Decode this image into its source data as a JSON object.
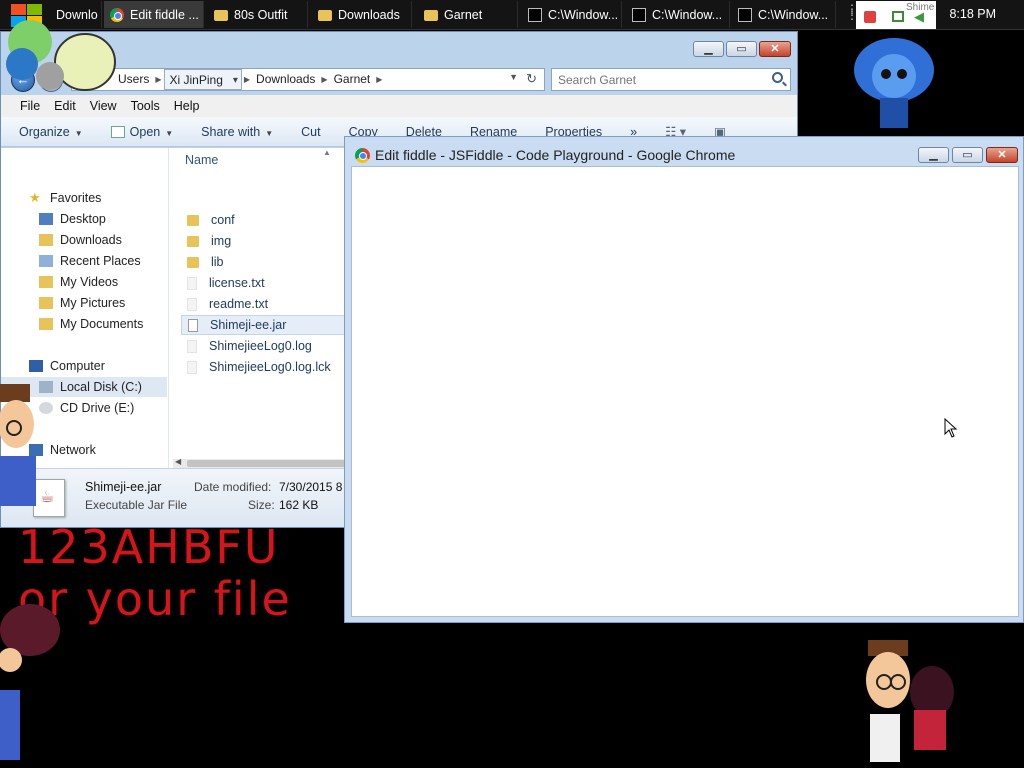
{
  "taskbar": {
    "items": [
      {
        "label": "Downlo"
      },
      {
        "label": "Edit fiddle ..."
      },
      {
        "label": "80s Outfit"
      },
      {
        "label": "Downloads"
      },
      {
        "label": "Garnet"
      },
      {
        "label": "C:\\Window..."
      },
      {
        "label": "C:\\Window..."
      },
      {
        "label": "C:\\Window..."
      }
    ],
    "tray_label": "Shime",
    "clock": "8:18 PM"
  },
  "explorer": {
    "breadcrumb": [
      "Users",
      "Xi JinPing",
      "Downloads",
      "Garnet"
    ],
    "search_placeholder": "Search Garnet",
    "menu": [
      "File",
      "Edit",
      "View",
      "Tools",
      "Help"
    ],
    "commands": {
      "organize": "Organize",
      "open": "Open",
      "share_with": "Share with",
      "cut": "Cut",
      "copy": "Copy",
      "delete": "Delete",
      "rename": "Rename",
      "properties": "Properties",
      "more": "»"
    },
    "nav": {
      "favorites": "Favorites",
      "desktop": "Desktop",
      "downloads": "Downloads",
      "recent_places": "Recent Places",
      "my_videos": "My Videos",
      "my_pictures": "My Pictures",
      "my_documents": "My Documents",
      "computer": "Computer",
      "local_disk": "Local Disk (C:)",
      "cd_drive": "CD Drive (E:)",
      "network": "Network"
    },
    "column_name": "Name",
    "files": [
      {
        "name": "conf"
      },
      {
        "name": "img"
      },
      {
        "name": "lib"
      },
      {
        "name": "license.txt"
      },
      {
        "name": "readme.txt"
      },
      {
        "name": "Shimeji-ee.jar"
      },
      {
        "name": "ShimejieeLog0.log"
      },
      {
        "name": "ShimejieeLog0.log.lck"
      }
    ],
    "details": {
      "name": "Shimeji-ee.jar",
      "type": "Executable Jar File",
      "modified_label": "Date modified:",
      "modified_value": "7/30/2015 8",
      "size_label": "Size:",
      "size_value": "162 KB"
    }
  },
  "chrome": {
    "title": "Edit fiddle - JSFiddle - Code Playground - Google Chrome"
  },
  "desktop": {
    "line1": "123AHBFU",
    "line2": "or your file"
  },
  "colors": {
    "accent_red": "#d8141b",
    "window_frame": "#bcd3ec"
  }
}
